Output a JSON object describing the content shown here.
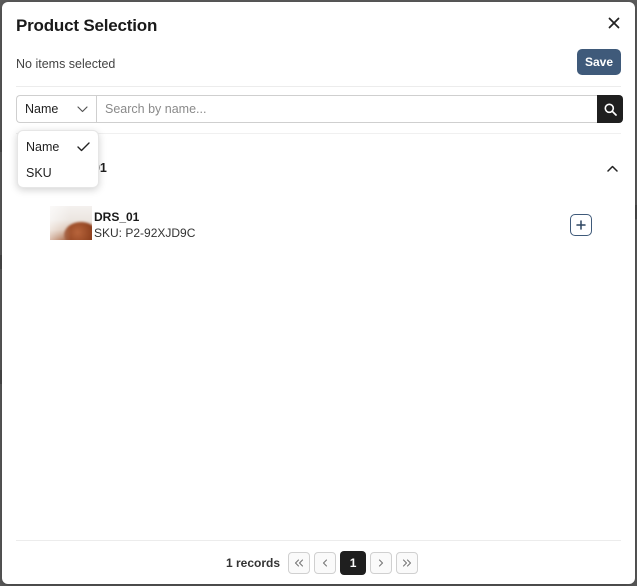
{
  "modal": {
    "title": "Product Selection",
    "selected_status": "No items selected",
    "save_label": "Save"
  },
  "search": {
    "field": "Name",
    "placeholder": "Search by name..."
  },
  "dropdown": {
    "options": [
      {
        "label": "Name",
        "selected": true
      },
      {
        "label": "SKU",
        "selected": false
      }
    ]
  },
  "group": {
    "title": "_01"
  },
  "product": {
    "name": "DRS_01",
    "sku": "SKU: P2-92XJD9C"
  },
  "pagination": {
    "records": "1 records",
    "current_page": "1"
  },
  "colors": {
    "accent": "#3f5a7a",
    "dark": "#1f1f1f"
  },
  "icons": [
    "close-icon",
    "chevron-down-icon",
    "search-icon",
    "checkmark-icon",
    "chevron-up-icon",
    "plus-icon",
    "double-chevron-left-icon",
    "chevron-left-icon",
    "chevron-right-icon",
    "double-chevron-right-icon"
  ]
}
